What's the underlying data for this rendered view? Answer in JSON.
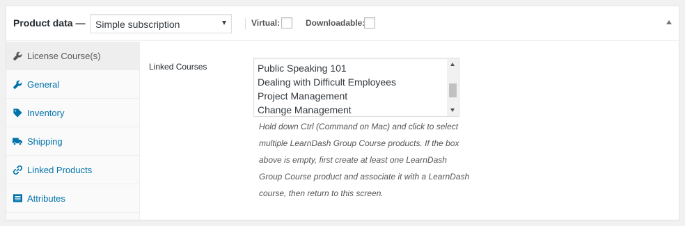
{
  "header": {
    "title": "Product data —",
    "product_type": "Simple subscription",
    "virtual_label": "Virtual:",
    "downloadable_label": "Downloadable:"
  },
  "tabs": [
    {
      "label": "License Course(s)",
      "icon": "wrench-icon",
      "active": true
    },
    {
      "label": "General",
      "icon": "wrench-icon",
      "active": false
    },
    {
      "label": "Inventory",
      "icon": "tag-icon",
      "active": false
    },
    {
      "label": "Shipping",
      "icon": "truck-icon",
      "active": false
    },
    {
      "label": "Linked Products",
      "icon": "link-icon",
      "active": false
    },
    {
      "label": "Attributes",
      "icon": "list-icon",
      "active": false
    }
  ],
  "panel": {
    "field_label": "Linked Courses",
    "courses": [
      "Public Speaking 101",
      "Dealing with Difficult Employees",
      "Project Management",
      "Change Management"
    ],
    "help_text": "Hold down Ctrl (Command on Mac) and click to select multiple LearnDash Group Course products. If the box above is empty, first create at least one LearnDash Group Course product and associate it with a LearnDash course, then return to this screen."
  },
  "colors": {
    "link": "#0073aa",
    "active_tab_bg": "#eeeeee",
    "tab_bg": "#fafafa"
  }
}
